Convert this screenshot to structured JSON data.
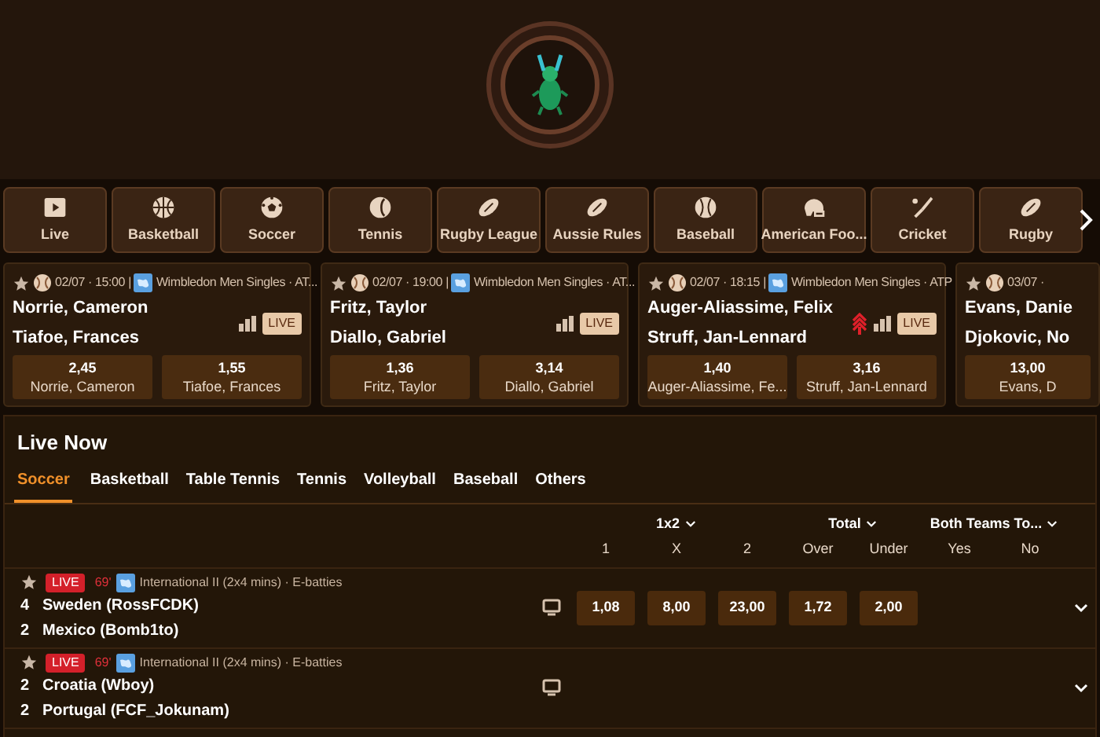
{
  "sports": [
    {
      "label": "Live",
      "kind": "live"
    },
    {
      "label": "Basketball",
      "kind": "basketball"
    },
    {
      "label": "Soccer",
      "kind": "soccer"
    },
    {
      "label": "Tennis",
      "kind": "tennis"
    },
    {
      "label": "Rugby League",
      "kind": "rugby"
    },
    {
      "label": "Aussie Rules",
      "kind": "rugby"
    },
    {
      "label": "Baseball",
      "kind": "baseball"
    },
    {
      "label": "American Foo...",
      "kind": "football"
    },
    {
      "label": "Cricket",
      "kind": "cricket"
    },
    {
      "label": "Rugby",
      "kind": "rugby"
    }
  ],
  "featured": [
    {
      "time": "02/07 · 15:00 |",
      "tournament": "Wimbledon Men Singles · AT...",
      "players": [
        "Norrie, Cameron",
        "Tiafoe, Frances"
      ],
      "live": "LIVE",
      "boosted": false,
      "odds": [
        {
          "value": "2,45",
          "name": "Norrie, Cameron"
        },
        {
          "value": "1,55",
          "name": "Tiafoe, Frances"
        }
      ]
    },
    {
      "time": "02/07 · 19:00 |",
      "tournament": "Wimbledon Men Singles · AT...",
      "players": [
        "Fritz, Taylor",
        "Diallo, Gabriel"
      ],
      "live": "LIVE",
      "boosted": false,
      "odds": [
        {
          "value": "1,36",
          "name": "Fritz, Taylor"
        },
        {
          "value": "3,14",
          "name": "Diallo, Gabriel"
        }
      ]
    },
    {
      "time": "02/07 · 18:15 |",
      "tournament": "Wimbledon Men Singles · ATP",
      "players": [
        "Auger-Aliassime, Felix",
        "Struff, Jan-Lennard"
      ],
      "live": "LIVE",
      "boosted": true,
      "odds": [
        {
          "value": "1,40",
          "name": "Auger-Aliassime, Fe..."
        },
        {
          "value": "3,16",
          "name": "Struff, Jan-Lennard"
        }
      ]
    },
    {
      "time": "03/07 ·",
      "players": [
        "Evans, Danie",
        "Djokovic, No"
      ],
      "boosted": false,
      "odds": [
        {
          "value": "13,00",
          "name": "Evans, D"
        }
      ]
    }
  ],
  "live_now": {
    "title": "Live Now",
    "tabs": [
      {
        "label": "Soccer",
        "selected": true
      },
      {
        "label": "Basketball",
        "selected": false
      },
      {
        "label": "Table Tennis",
        "selected": false
      },
      {
        "label": "Tennis",
        "selected": false
      },
      {
        "label": "Volleyball",
        "selected": false
      },
      {
        "label": "Baseball",
        "selected": false
      },
      {
        "label": "Others",
        "selected": false
      }
    ],
    "markets": [
      {
        "label": "1x2",
        "columns": [
          "1",
          "X",
          "2"
        ]
      },
      {
        "label": "Total",
        "columns": [
          "Over",
          "Under"
        ]
      },
      {
        "label": "Both Teams To...",
        "columns": [
          "Yes",
          "No"
        ]
      }
    ],
    "matches": [
      {
        "badge": "LIVE",
        "minute": "69'",
        "league": "International II (2x4 mins)  ·  E-batties",
        "teams": [
          {
            "score": "4",
            "name": "Sweden (RossFCDK)"
          },
          {
            "score": "2",
            "name": "Mexico (Bomb1to)"
          }
        ],
        "odds": [
          "1,08",
          "8,00",
          "23,00",
          "1,72",
          "2,00"
        ]
      },
      {
        "badge": "LIVE",
        "minute": "69'",
        "league": "International II (2x4 mins)  ·  E-batties",
        "teams": [
          {
            "score": "2",
            "name": "Croatia (Wboy)"
          },
          {
            "score": "2",
            "name": "Portugal (FCF_Jokunam)"
          }
        ]
      }
    ]
  }
}
